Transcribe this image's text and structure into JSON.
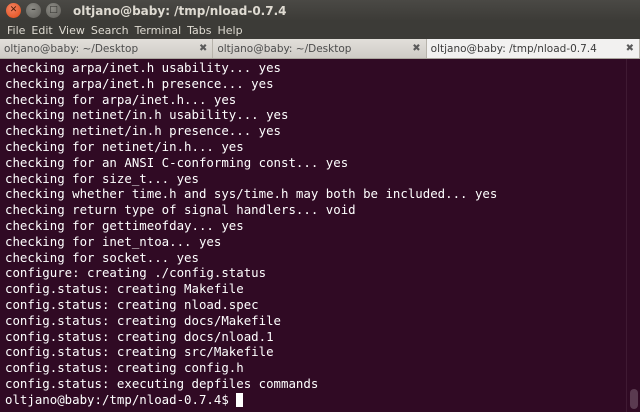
{
  "window": {
    "title": "oltjano@baby: /tmp/nload-0.7.4",
    "close_glyph": "✕",
    "min_glyph": "–",
    "max_glyph": "□"
  },
  "menu": [
    "File",
    "Edit",
    "View",
    "Search",
    "Terminal",
    "Tabs",
    "Help"
  ],
  "tabs": [
    {
      "label": "oltjano@baby: ~/Desktop",
      "close": "✖",
      "active": false
    },
    {
      "label": "oltjano@baby: ~/Desktop",
      "close": "✖",
      "active": false
    },
    {
      "label": "oltjano@baby: /tmp/nload-0.7.4",
      "close": "✖",
      "active": true
    }
  ],
  "terminal": {
    "lines": [
      "checking arpa/inet.h usability... yes",
      "checking arpa/inet.h presence... yes",
      "checking for arpa/inet.h... yes",
      "checking netinet/in.h usability... yes",
      "checking netinet/in.h presence... yes",
      "checking for netinet/in.h... yes",
      "checking for an ANSI C-conforming const... yes",
      "checking for size_t... yes",
      "checking whether time.h and sys/time.h may both be included... yes",
      "checking return type of signal handlers... void",
      "checking for gettimeofday... yes",
      "checking for inet_ntoa... yes",
      "checking for socket... yes",
      "configure: creating ./config.status",
      "config.status: creating Makefile",
      "config.status: creating nload.spec",
      "config.status: creating docs/Makefile",
      "config.status: creating docs/nload.1",
      "config.status: creating src/Makefile",
      "config.status: creating config.h",
      "config.status: executing depfiles commands"
    ],
    "prompt": "oltjano@baby:/tmp/nload-0.7.4$",
    "colors": {
      "background": "#300a24",
      "foreground": "#ffffff"
    }
  }
}
